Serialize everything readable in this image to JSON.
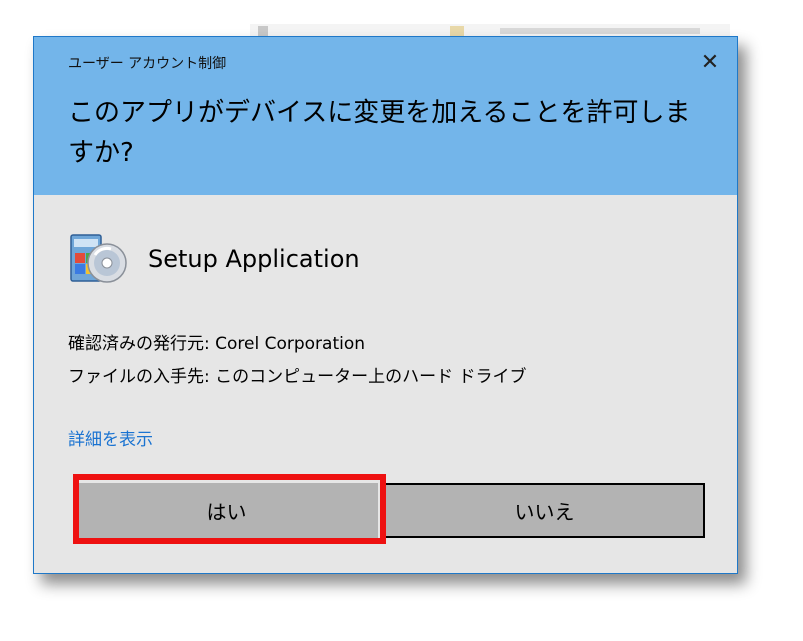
{
  "dialog": {
    "caption": "ユーザー アカウント制御",
    "close_glyph": "✕",
    "question": "このアプリがデバイスに変更を加えることを許可しますか?",
    "app_name": "Setup Application",
    "publisher_line": "確認済みの発行元: Corel Corporation",
    "origin_line": "ファイルの入手先: このコンピューター上のハード ドライブ",
    "details_link": "詳細を表示",
    "yes_button": "はい",
    "no_button": "いいえ"
  },
  "icons": {
    "close": "close-icon",
    "app": "setup-disc-icon"
  },
  "colors": {
    "header_bg": "#73b5ea",
    "body_bg": "#e6e6e6",
    "link": "#1a73d1",
    "button_bg": "#b3b3b3",
    "highlight": "#ee1111",
    "border": "#1f78c8"
  }
}
